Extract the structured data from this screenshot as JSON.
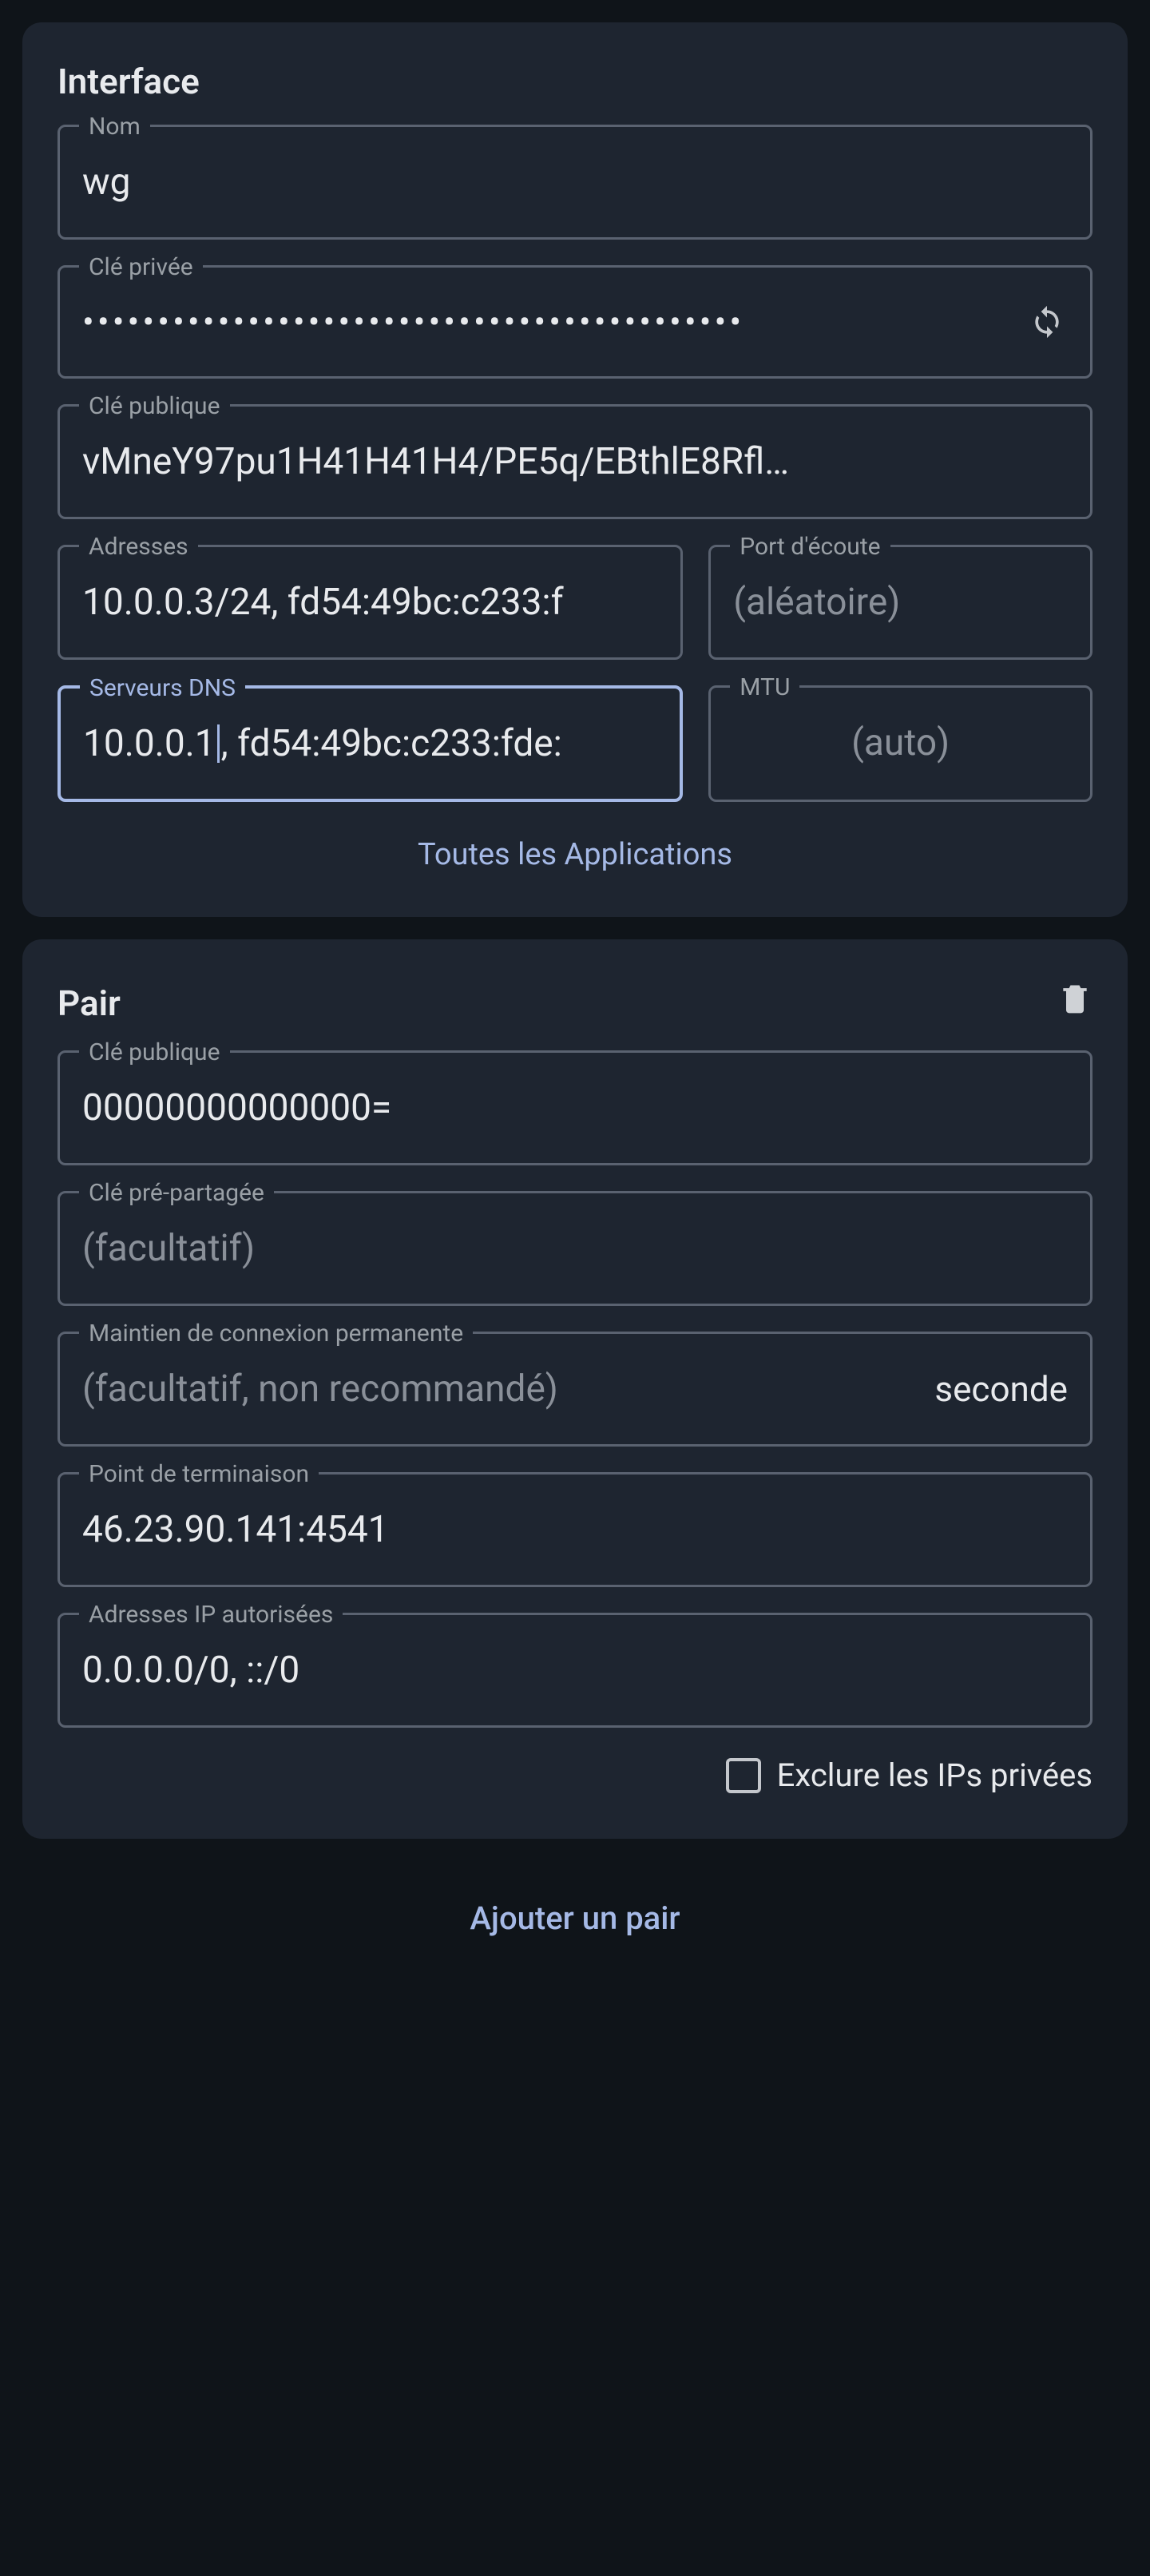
{
  "interface": {
    "title": "Interface",
    "name": {
      "label": "Nom",
      "value": "wg"
    },
    "private_key": {
      "label": "Clé privée",
      "masked": "••••••••••••••••••••••••••••••••••••••••••••"
    },
    "public_key": {
      "label": "Clé publique",
      "value": "vMneY97pu1H41H41H4/PE5q/EBthlE8Rfl…"
    },
    "addresses": {
      "label": "Adresses",
      "value": "10.0.0.3/24, fd54:49bc:c233:f"
    },
    "listen_port": {
      "label": "Port d'écoute",
      "placeholder": "(aléatoire)"
    },
    "dns": {
      "label": "Serveurs DNS",
      "value_before": "10.0.0.1",
      "value_after": ", fd54:49bc:c233:fde:"
    },
    "mtu": {
      "label": "MTU",
      "placeholder": "(auto)"
    },
    "all_apps": "Toutes les Applications"
  },
  "peer": {
    "title": "Pair",
    "public_key": {
      "label": "Clé publique",
      "value": "00000000000000="
    },
    "preshared": {
      "label": "Clé pré-partagée",
      "placeholder": "(facultatif)"
    },
    "keepalive": {
      "label": "Maintien de connexion permanente",
      "placeholder": "(facultatif, non recommandé)",
      "unit": "seconde"
    },
    "endpoint": {
      "label": "Point de terminaison",
      "value": "46.23.90.141:4541"
    },
    "allowed_ips": {
      "label": "Adresses IP autorisées",
      "value": "0.0.0.0/0, ::/0"
    },
    "exclude_private": "Exclure les IPs privées"
  },
  "add_peer": "Ajouter un pair"
}
